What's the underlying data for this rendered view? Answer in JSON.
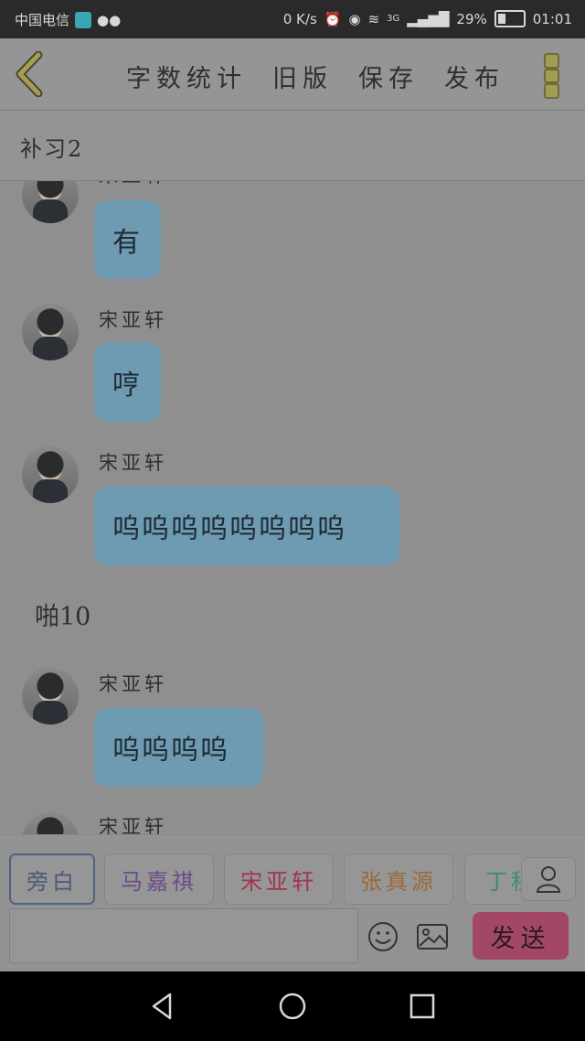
{
  "status_bar": {
    "carrier": "中国电信",
    "net_speed": "0 K/s",
    "network_type": "3G",
    "battery_percent": "29%",
    "time": "01:01"
  },
  "toolbar": {
    "items": [
      "字数统计",
      "旧版",
      "保存",
      "发布"
    ]
  },
  "chapter": {
    "title": "补习2"
  },
  "messages": [
    {
      "sender": "宋亚轩",
      "text": "有"
    },
    {
      "sender": "宋亚轩",
      "text": "哼"
    },
    {
      "sender": "宋亚轩",
      "text": "呜呜呜呜呜呜呜呜"
    },
    {
      "narration": "啪10"
    },
    {
      "sender": "宋亚轩",
      "text": "呜呜呜呜"
    },
    {
      "sender": "宋亚轩",
      "text": ""
    }
  ],
  "characters": [
    {
      "name": "旁白",
      "color": "#4a5a7a"
    },
    {
      "name": "马嘉祺",
      "color": "#6b4a8a"
    },
    {
      "name": "宋亚轩",
      "color": "#a3344e"
    },
    {
      "name": "张真源",
      "color": "#9a6a3a"
    },
    {
      "name": "丁程鑫",
      "color": "#3a8a7a"
    }
  ],
  "input": {
    "value": "",
    "placeholder": ""
  },
  "send_label": "发送"
}
